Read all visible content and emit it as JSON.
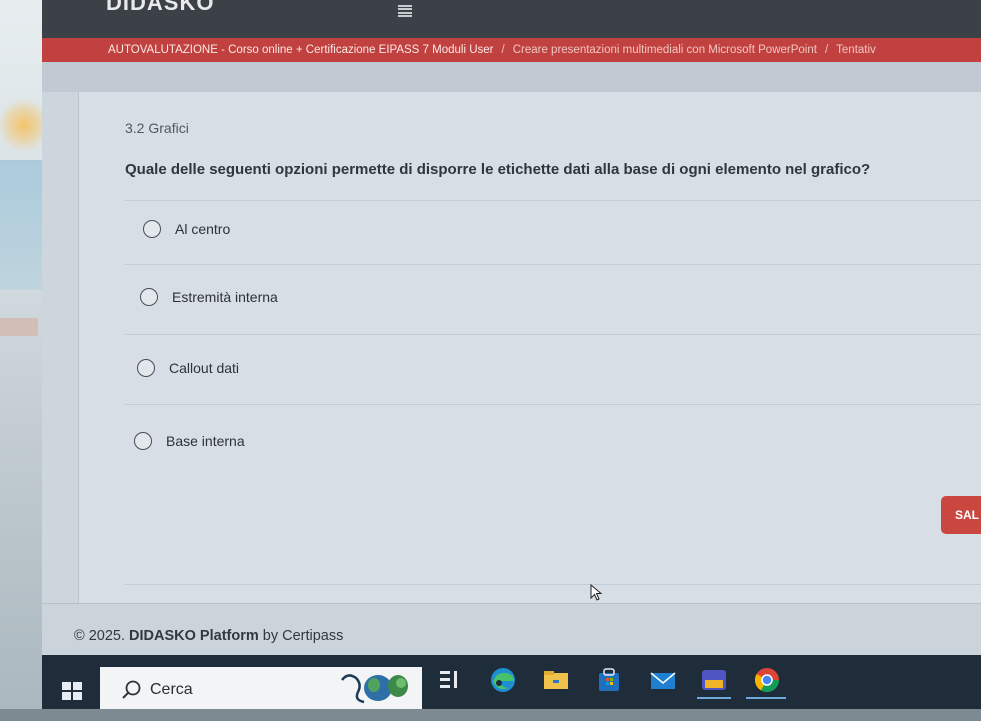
{
  "app": {
    "brand": "DIDASKO"
  },
  "breadcrumb": {
    "main": "AUTOVALUTAZIONE - Corso online + Certificazione EIPASS 7 Moduli User",
    "sep1": "/",
    "mid": "Creare presentazioni multimediali con Microsoft PowerPoint",
    "sep2": "/",
    "last": "Tentativ"
  },
  "quiz": {
    "section": "3.2 Grafici",
    "question": "Quale delle seguenti opzioni permette di disporre le etichette dati alla base di ogni elemento nel grafico?",
    "options": [
      {
        "label": "Al centro",
        "selected": false
      },
      {
        "label": "Estremità interna",
        "selected": false
      },
      {
        "label": "Callout dati",
        "selected": false
      },
      {
        "label": "Base interna",
        "selected": false
      }
    ],
    "save_button": "SAL"
  },
  "footer": {
    "copyright": "© 2025.",
    "platform": "DIDASKO Platform",
    "by": "by Certipass"
  },
  "taskbar": {
    "search_label": "Cerca",
    "icons": [
      "windows-start-icon",
      "search-icon",
      "task-view-icon",
      "edge-icon",
      "file-explorer-icon",
      "store-icon",
      "mail-icon",
      "teams-icon",
      "chrome-icon"
    ]
  },
  "colors": {
    "breadcrumb_bg": "#c0413f",
    "topbar_bg": "#3b4147",
    "save_button_bg": "#c9473f",
    "taskbar_bg": "#1f2c3a"
  }
}
